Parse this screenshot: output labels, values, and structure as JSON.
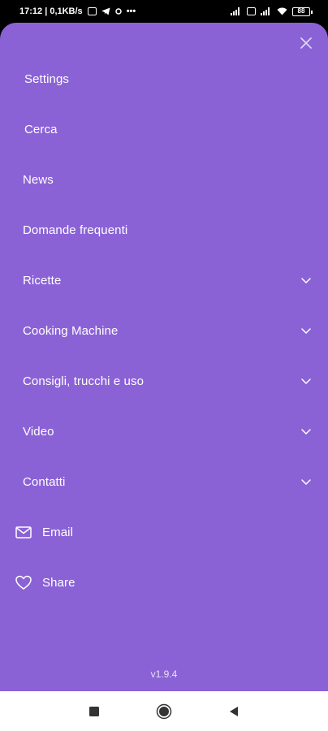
{
  "status_bar": {
    "time_speed": "17:12 | 0,1KB/s",
    "icons": [
      "message-icon",
      "telegram-icon",
      "data-saver-icon",
      "more-dots-icon",
      "signal-icon",
      "signal-icon",
      "sim-icon",
      "wifi-icon",
      "battery-icon"
    ],
    "battery": "88"
  },
  "drawer": {
    "background": "#8b62d6",
    "close_icon": "close-icon",
    "menu": [
      {
        "label": "Settings",
        "expandable": false
      },
      {
        "label": "Cerca",
        "expandable": false
      },
      {
        "label": "News",
        "expandable": false
      },
      {
        "label": "Domande frequenti",
        "expandable": false
      },
      {
        "label": "Ricette",
        "expandable": true
      },
      {
        "label": "Cooking Machine",
        "expandable": true
      },
      {
        "label": "Consigli, trucchi e uso",
        "expandable": true
      },
      {
        "label": "Video",
        "expandable": true
      },
      {
        "label": "Contatti",
        "expandable": true
      },
      {
        "label": "Email",
        "icon": "email-icon"
      },
      {
        "label": "Share",
        "icon": "heart-icon"
      }
    ],
    "version": "v1.9.4"
  },
  "nav_bar": {
    "buttons": [
      "recents-square-icon",
      "home-circle-icon",
      "back-triangle-icon"
    ]
  }
}
